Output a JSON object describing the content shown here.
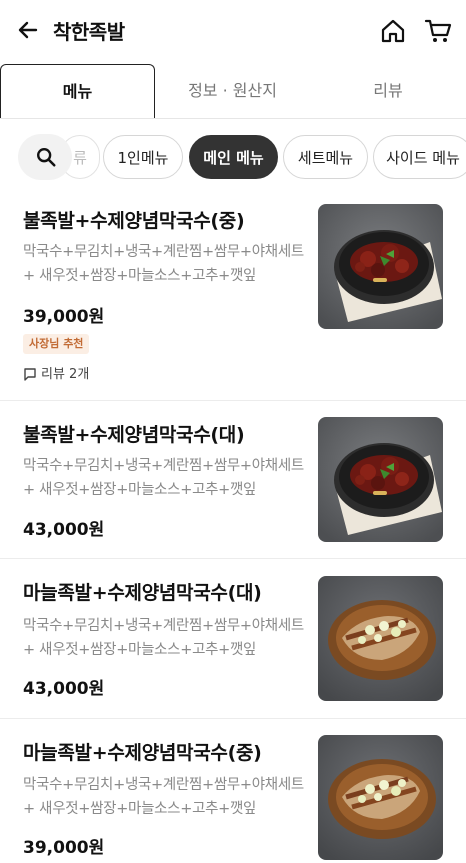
{
  "appbar": {
    "title": "착한족발"
  },
  "tabs": [
    {
      "label": "메뉴"
    },
    {
      "label": "정보 · 원산지"
    },
    {
      "label": "리뷰"
    }
  ],
  "chips": [
    {
      "label": "류"
    },
    {
      "label": "1인메뉴"
    },
    {
      "label": "메인 메뉴"
    },
    {
      "label": "세트메뉴"
    },
    {
      "label": "사이드 메뉴"
    }
  ],
  "menu": [
    {
      "name": "불족발+수제양념막국수(중)",
      "desc_line1": "막국수+무김치+냉국+계란찜+쌈무+야채세트",
      "desc_line2": "+ 새우젓+쌈장+마늘소스+고추+깻잎",
      "price": "39,000원",
      "badge": "사장님 추천",
      "review": "리뷰 2개",
      "image": "spicy-pork-trotter-dish"
    },
    {
      "name": "불족발+수제양념막국수(대)",
      "desc_line1": "막국수+무김치+냉국+계란찜+쌈무+야채세트",
      "desc_line2": "+ 새우젓+쌈장+마늘소스+고추+깻잎",
      "price": "43,000원",
      "image": "spicy-pork-trotter-dish"
    },
    {
      "name": "마늘족발+수제양념막국수(대)",
      "desc_line1": "막국수+무김치+냉국+계란찜+쌈무+야채세트",
      "desc_line2": "+ 새우젓+쌈장+마늘소스+고추+깻잎",
      "price": "43,000원",
      "image": "garlic-pork-trotter-dish"
    },
    {
      "name": "마늘족발+수제양념막국수(중)",
      "desc_line1": "막국수+무김치+냉국+계란찜+쌈무+야채세트",
      "desc_line2": "+ 새우젓+쌈장+마늘소스+고추+깻잎",
      "price": "39,000원",
      "image": "garlic-pork-trotter-dish"
    }
  ]
}
